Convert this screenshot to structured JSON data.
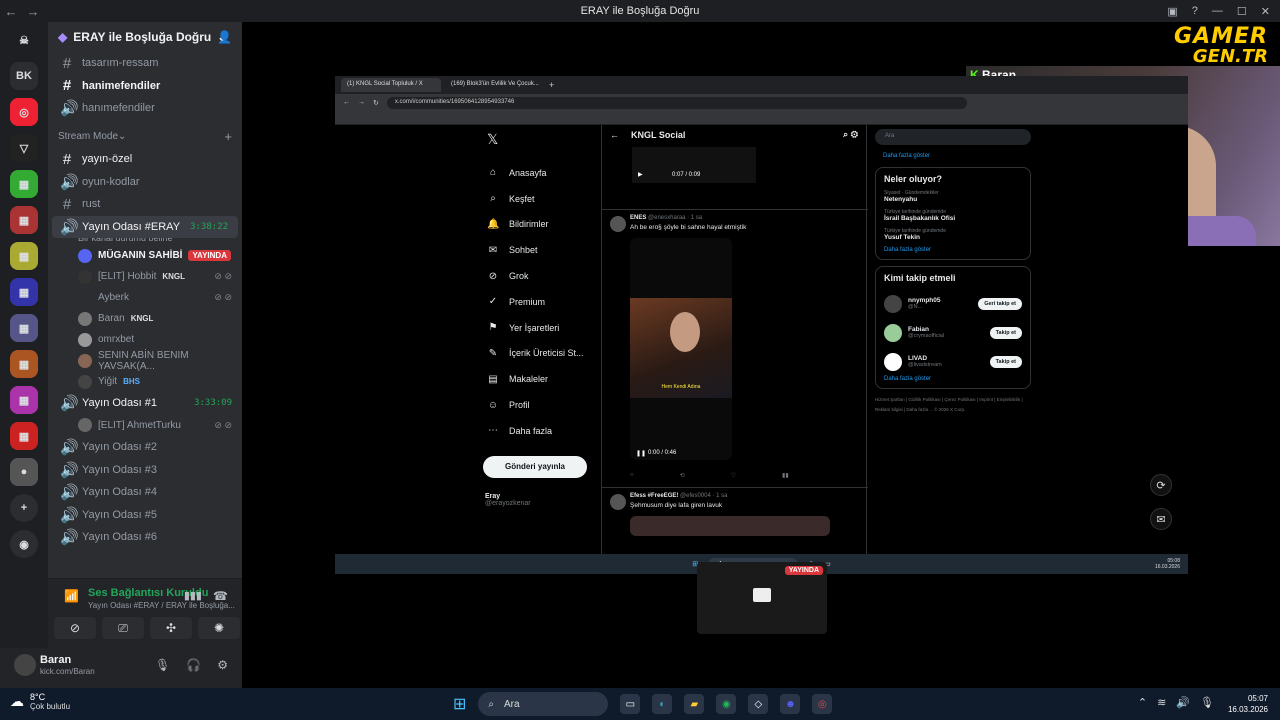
{
  "window": {
    "title": "ERAY ile Boşluğa Doğru"
  },
  "servers": [
    "BK",
    "",
    "",
    "",
    "",
    "",
    "",
    "",
    "",
    "",
    "",
    "",
    ""
  ],
  "sidebar": {
    "server_name": "ERAY ile Boşluğa Doğru",
    "channels_top": [
      {
        "name": "tasarım-ressam",
        "icon": "#"
      },
      {
        "name": "hanimefendiler",
        "icon": "#"
      },
      {
        "name": "hanımefendiler",
        "icon": "🔊"
      }
    ],
    "category": "Stream Mode",
    "channels": [
      {
        "name": "yayın-özel"
      },
      {
        "name": "oyun-kodlar"
      },
      {
        "name": "rust"
      }
    ],
    "voice_active": {
      "name": "Yayın Odası #ERAY",
      "timer": "3:38:22",
      "status": "Bir kanal durumu belirle"
    },
    "users": [
      {
        "name": "MÜGANIN SAHİBİ",
        "badge": "YAYINDA"
      },
      {
        "name": "[ELIT] Hobbit",
        "tag": "KNGL"
      },
      {
        "name": "Ayberk"
      },
      {
        "name": "Baran",
        "tag": "KNGL"
      },
      {
        "name": "omrxbet"
      },
      {
        "name": "SENIN ABİN BENIM YAVSAK(A..."
      },
      {
        "name": "Yiğit",
        "tag": "BHS"
      }
    ],
    "voice_room1": {
      "name": "Yayın Odası #1",
      "timer": "3:33:09"
    },
    "room1_users": [
      {
        "name": "[ELIT] AhmetTurku"
      }
    ],
    "voice_rooms": [
      "Yayın Odası #2",
      "Yayın Odası #3",
      "Yayın Odası #4",
      "Yayın Odası #5",
      "Yayın Odası #6"
    ]
  },
  "voice": {
    "status": "Ses Bağlantısı Kuruldu",
    "detail": "Yayın Odası #ERAY / ERAY ile Boşluğa..."
  },
  "user_panel": {
    "name": "Baran",
    "status": "kick.com/Baran"
  },
  "overlay": {
    "logo_line1": "GAMER",
    "logo_line2": "GEN.TR",
    "cam_name": "Baran"
  },
  "browser": {
    "tabs": [
      "(1) KNGL Social Topluluk / X",
      "(169) Blok3'ün Evlilik Ve Çocuk..."
    ],
    "url": "x.com/i/communities/1695064128954933746"
  },
  "x": {
    "nav": [
      {
        "label": "Anasayfa",
        "icon": "⌂"
      },
      {
        "label": "Keşfet",
        "icon": "⌕"
      },
      {
        "label": "Bildirimler",
        "icon": "🔔"
      },
      {
        "label": "Sohbet",
        "icon": "✉"
      },
      {
        "label": "Grok",
        "icon": "⊘"
      },
      {
        "label": "Premium",
        "icon": "✓"
      },
      {
        "label": "Yer İşaretleri",
        "icon": "⚑"
      },
      {
        "label": "İçerik Üreticisi St...",
        "icon": "✎"
      },
      {
        "label": "Makaleler",
        "icon": "▤"
      },
      {
        "label": "Profil",
        "icon": "☺"
      },
      {
        "label": "Daha fazla",
        "icon": "⋯"
      }
    ],
    "post_button": "Gönderi yayınla",
    "profile": {
      "name": "Eray",
      "handle": "@erayozkenar"
    },
    "feed_title": "KNGL Social",
    "video1_time": "0:07 / 0:09",
    "posts": [
      {
        "author": "ENES",
        "handle": "@enesxharaa · 1 sa",
        "text": "Ah be ero§ şöyle bi sahne hayal etmiştik",
        "video_caption": "Hem Kendi Adına",
        "video_time": "0:00 / 0:46"
      },
      {
        "author": "Efess #FreeEGE!",
        "handle": "@efes0004 · 1 sa",
        "text": "Şehmusum diye lafa giren lavuk"
      }
    ],
    "search_placeholder": "Ara",
    "trends_title": "Neler oluyor?",
    "trends": [
      {
        "meta": "Siyaset · Gündemdekiler",
        "name": "Netenyahu"
      },
      {
        "meta": "Türkiye tarihinde gündemde",
        "name": "İsrail Başbakanlık Ofisi"
      },
      {
        "meta": "Türkiye tarihinde gündemde",
        "name": "Yusuf Tekin"
      }
    ],
    "more_label": "Daha fazla göster",
    "follow_title": "Kimi takip etmeli",
    "follows": [
      {
        "name": "nnymph05",
        "handle": "@N...",
        "button": "Geri takip et"
      },
      {
        "name": "Fabian",
        "handle": "@crymaofficial",
        "button": "Takip et"
      },
      {
        "name": "LIVAD",
        "handle": "@livadstream",
        "button": "Takip et"
      }
    ],
    "footer": "Hizmet Şartları | Gizlilik Politikası | Çerez Politikası | Imprint | Erişilebilirlik | Reklam bilgisi | Daha fazla ... © 2026 X Corp."
  },
  "inner_taskbar": {
    "search": "Ara",
    "time": "05:08",
    "date": "16.03.2026"
  },
  "preview": {
    "live": "YAYINDA"
  },
  "taskbar": {
    "temp": "8°C",
    "weather": "Çok bulutlu",
    "search": "Ara",
    "time": "05:07",
    "date": "16.03.2026"
  }
}
